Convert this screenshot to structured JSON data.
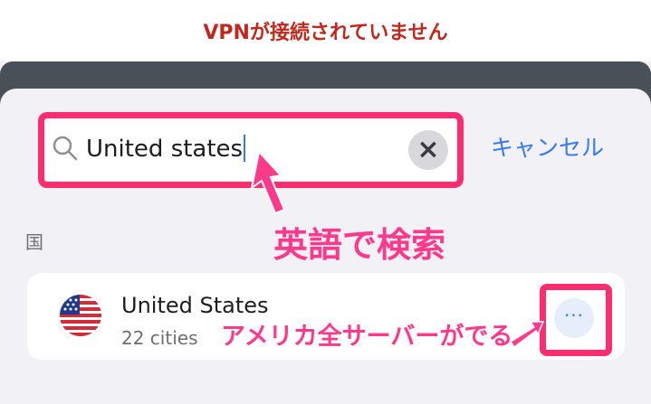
{
  "status": {
    "message": "VPNが接続されていません",
    "color": "#c0281e"
  },
  "search": {
    "value": "United states",
    "clear_icon": "clear-icon",
    "search_icon": "search-icon"
  },
  "cancel_label": "キャンセル",
  "annotations": {
    "search_note": "英語で検索",
    "servers_note": "アメリカ全サーバーがでる",
    "highlight_color": "#ff2d6f",
    "text_color": "#ff3a8c"
  },
  "section": {
    "label": "国"
  },
  "results": [
    {
      "name": "United States",
      "subtitle": "22 cities",
      "flag_icon": "us-flag-icon",
      "more_label": "···"
    }
  ],
  "colors": {
    "accent": "#3478f6",
    "background": "#f2f2f6"
  }
}
